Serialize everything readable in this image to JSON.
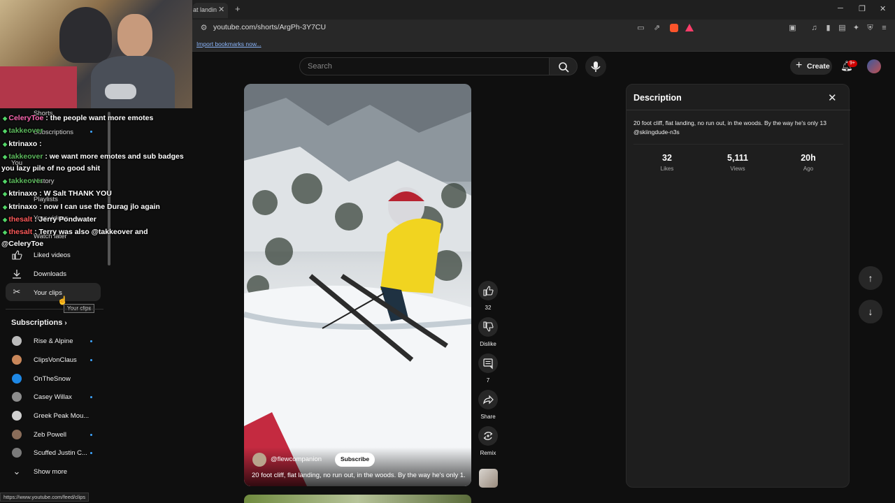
{
  "browser": {
    "tab_title": "at landin",
    "url": "youtube.com/shorts/ArgPh-3Y7CU",
    "bookmark_link": "Import bookmarks now...",
    "status_url": "https://www.youtube.com/feed/clips"
  },
  "masthead": {
    "search_placeholder": "Search",
    "create_label": "Create",
    "notification_count": "9+"
  },
  "sidebar": {
    "top_items": [
      {
        "label": "Shorts"
      },
      {
        "label": "Subscriptions"
      },
      {
        "label": "You"
      },
      {
        "label": "History"
      },
      {
        "label": "Playlists"
      },
      {
        "label": "Your videos"
      },
      {
        "label": "Watch later"
      }
    ],
    "items": [
      {
        "label": "Liked videos",
        "icon": "thumb-up-icon"
      },
      {
        "label": "Downloads",
        "icon": "download-icon"
      },
      {
        "label": "Your clips",
        "icon": "scissors-icon"
      }
    ],
    "tooltip": "Your clips",
    "subscriptions_header": "Subscriptions",
    "subscriptions": [
      {
        "label": "Rise & Alpine",
        "color": "#bbbbbb"
      },
      {
        "label": "ClipsVonClaus",
        "color": "#c9875a"
      },
      {
        "label": "OnTheSnow",
        "color": "#1e88e5"
      },
      {
        "label": "Casey Willax",
        "color": "#8d8d8d"
      },
      {
        "label": "Greek Peak Mou...",
        "color": "#d0d0d0"
      },
      {
        "label": "Zeb Powell",
        "color": "#8a6d5a"
      },
      {
        "label": "Scuffed Justin C...",
        "color": "#7a7a7a"
      }
    ],
    "show_more": "Show more"
  },
  "chat": [
    {
      "user": "CeleryToe",
      "user_color": "#ff69b4",
      "text": " : the people want more emotes"
    },
    {
      "user": "takkeover",
      "user_color": "#5cb85c",
      "text": ""
    },
    {
      "user": "ktrinaxo",
      "user_color": "#ffffff",
      "text": " : "
    },
    {
      "user": "takkeover",
      "user_color": "#5cb85c",
      "text": " : we want more emotes and sub badges"
    },
    {
      "user": "",
      "user_color": "#ffffff",
      "text": "you lazy pile of no good shit"
    },
    {
      "user": "takkeover",
      "user_color": "#5cb85c",
      "text": ""
    },
    {
      "user": "ktrinaxo",
      "user_color": "#ffffff",
      "text": " : W Salt THANK YOU"
    },
    {
      "user": "ktrinaxo",
      "user_color": "#ffffff",
      "text": " : now I can use the Durag jlo again"
    },
    {
      "user": "thesalt",
      "user_color": "#ff5a5a",
      "text": " : Jerry Pondwater"
    },
    {
      "user": "thesalt",
      "user_color": "#ff5a5a",
      "text": " : Terry was also @takkeover and"
    },
    {
      "user": "",
      "user_color": "#ffffff",
      "text": "@CeleryToe"
    }
  ],
  "video": {
    "channel": "@flewcompanion",
    "subscribe_label": "Subscribe",
    "caption": "20 foot cliff, flat landing, no run out, in the woods. By the way he's only 1..."
  },
  "actions": {
    "like_count": "32",
    "dislike_label": "Dislike",
    "comment_count": "7",
    "share_label": "Share",
    "remix_label": "Remix"
  },
  "description": {
    "title": "Description",
    "text": "20 foot cliff, flat landing, no run out, in the woods. By the way he's only 13 @skiingdude-n3s",
    "stats": [
      {
        "value": "32",
        "label": "Likes"
      },
      {
        "value": "5,111",
        "label": "Views"
      },
      {
        "value": "20h",
        "label": "Ago"
      }
    ]
  }
}
